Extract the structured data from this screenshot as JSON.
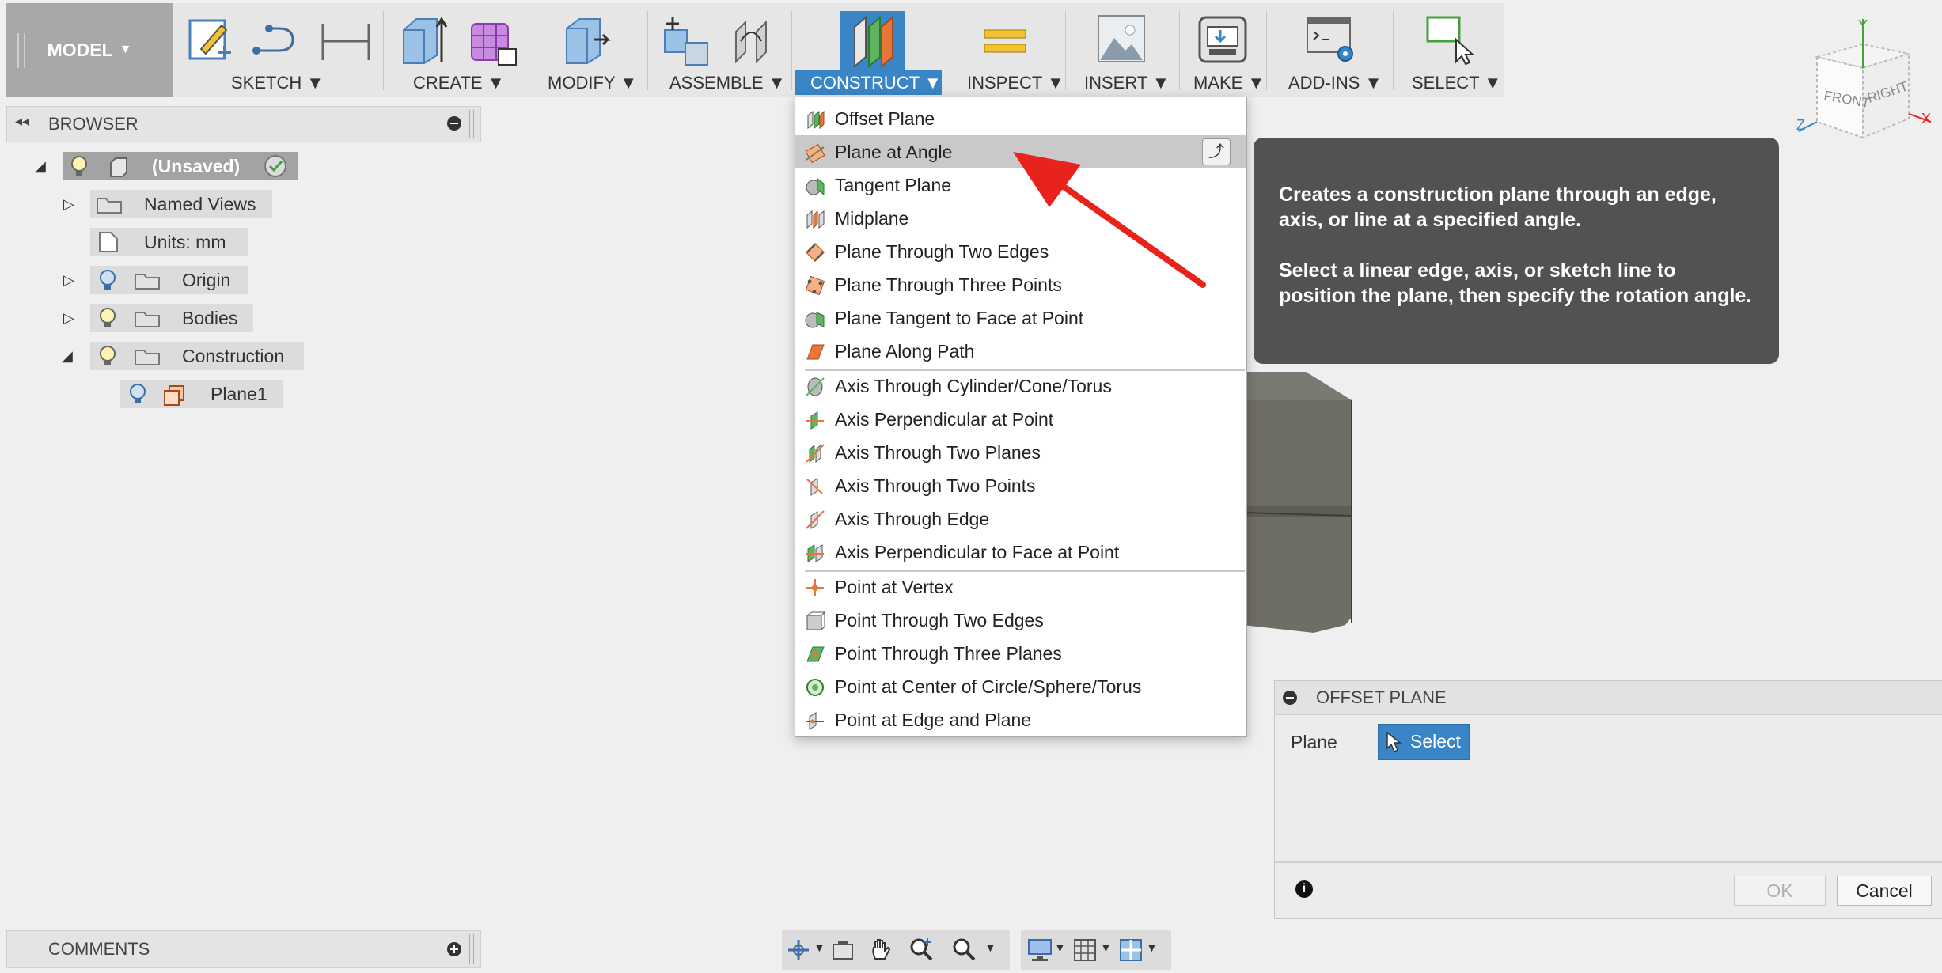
{
  "toolbar": {
    "workspace": "MODEL",
    "sections": [
      {
        "label": "SKETCH"
      },
      {
        "label": "CREATE"
      },
      {
        "label": "MODIFY"
      },
      {
        "label": "ASSEMBLE"
      },
      {
        "label": "CONSTRUCT"
      },
      {
        "label": "INSPECT"
      },
      {
        "label": "INSERT"
      },
      {
        "label": "MAKE"
      },
      {
        "label": "ADD-INS"
      },
      {
        "label": "SELECT"
      }
    ],
    "dropdown_glyph": "▼"
  },
  "browser": {
    "title": "BROWSER",
    "items": [
      {
        "label": "(Unsaved)"
      },
      {
        "label": "Named Views"
      },
      {
        "label": "Units: mm"
      },
      {
        "label": "Origin"
      },
      {
        "label": "Bodies"
      },
      {
        "label": "Construction"
      },
      {
        "label": "Plane1"
      }
    ]
  },
  "construct_menu": {
    "groups": [
      [
        {
          "label": "Offset Plane",
          "icon": "offset-plane-icon"
        },
        {
          "label": "Plane at Angle",
          "icon": "plane-at-angle-icon"
        },
        {
          "label": "Tangent Plane",
          "icon": "tangent-plane-icon"
        },
        {
          "label": "Midplane",
          "icon": "midplane-icon"
        },
        {
          "label": "Plane Through Two Edges",
          "icon": "plane-two-edges-icon"
        },
        {
          "label": "Plane Through Three Points",
          "icon": "plane-three-points-icon"
        },
        {
          "label": "Plane Tangent to Face at Point",
          "icon": "plane-tangent-face-icon"
        },
        {
          "label": "Plane Along Path",
          "icon": "plane-along-path-icon"
        }
      ],
      [
        {
          "label": "Axis Through Cylinder/Cone/Torus",
          "icon": "axis-cylinder-icon"
        },
        {
          "label": "Axis Perpendicular at Point",
          "icon": "axis-perp-point-icon"
        },
        {
          "label": "Axis Through Two Planes",
          "icon": "axis-two-planes-icon"
        },
        {
          "label": "Axis Through Two Points",
          "icon": "axis-two-points-icon"
        },
        {
          "label": "Axis Through Edge",
          "icon": "axis-edge-icon"
        },
        {
          "label": "Axis Perpendicular to Face at Point",
          "icon": "axis-perp-face-icon"
        }
      ],
      [
        {
          "label": "Point at Vertex",
          "icon": "point-vertex-icon"
        },
        {
          "label": "Point Through Two Edges",
          "icon": "point-two-edges-icon"
        },
        {
          "label": "Point Through Three Planes",
          "icon": "point-three-planes-icon"
        },
        {
          "label": "Point at Center of Circle/Sphere/Torus",
          "icon": "point-center-icon"
        },
        {
          "label": "Point at Edge and Plane",
          "icon": "point-edge-plane-icon"
        }
      ]
    ],
    "highlighted": "Plane at Angle"
  },
  "tooltip": {
    "line1": "Creates a construction plane through an edge, axis, or line at a specified angle.",
    "line2": "Select a linear edge, axis, or sketch line to position the plane, then specify the rotation angle."
  },
  "dialog": {
    "title": "OFFSET PLANE",
    "field_label": "Plane",
    "select_label": "Select",
    "ok_label": "OK",
    "cancel_label": "Cancel"
  },
  "viewcube": {
    "front": "FRONT",
    "right": "RIGHT",
    "axis_x": "X",
    "axis_y": "Y",
    "axis_z": "Z"
  },
  "comments": {
    "title": "COMMENTS"
  },
  "colors": {
    "accent": "#3a85c6",
    "annotation_arrow": "#e8231b",
    "tooltip_bg": "#525252",
    "body_gray": "#6f6e66"
  }
}
